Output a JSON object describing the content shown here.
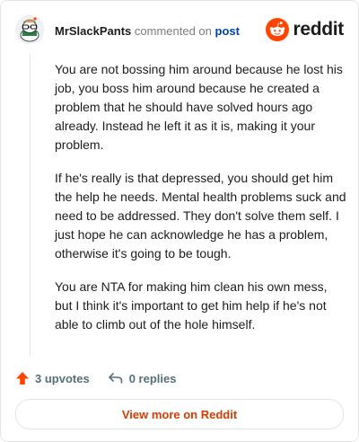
{
  "comment": {
    "author": "MrSlackPants",
    "action_text": "commented on",
    "post_link_label": "post",
    "paragraphs": [
      "You are not bossing him around because he lost his job, you boss him around because he created a problem that he should have solved hours ago already. Instead he left it as it is, making it your problem.",
      "If he's really is that depressed, you should get him the help he needs. Mental health problems suck and need to be addressed. They don't solve them self. I just hope he can acknowledge he has a problem, otherwise it's going to be tough.",
      "You are NTA for making him clean his own mess, but I think it's important to get him help if he's not able to climb out of the hole himself."
    ]
  },
  "brand": {
    "wordmark": "reddit",
    "icon": "reddit-logo-icon",
    "color": "#ff4500"
  },
  "actions": {
    "upvotes_label": "3 upvotes",
    "upvote_icon": "upvote-arrow-icon",
    "replies_label": "0 replies",
    "reply_icon": "reply-arrow-icon"
  },
  "footer": {
    "view_more_label": "View more on Reddit"
  },
  "colors": {
    "accent": "#d93a00",
    "upvote": "#ff4500",
    "link": "#0045ac",
    "muted": "#576f76",
    "border": "#e3e6e8"
  }
}
